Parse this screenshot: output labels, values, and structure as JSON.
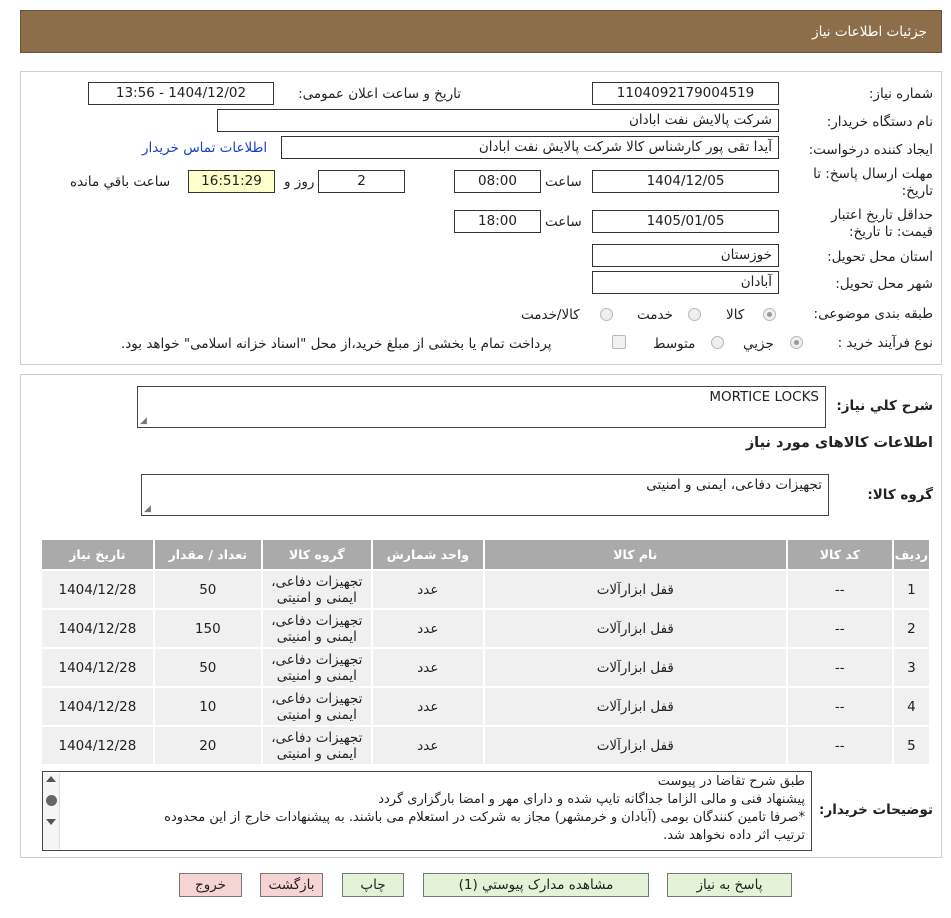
{
  "header": {
    "title": "جزئیات اطلاعات نیاز"
  },
  "form": {
    "need_number_label": "شماره نیاز:",
    "need_number": "1104092179004519",
    "announce_label": "تاریخ و ساعت اعلان عمومی:",
    "announce_value": "1404/12/02 - 13:56",
    "buyer_org_label": "نام دستگاه خریدار:",
    "buyer_org": "شرکت پالایش نفت ابادان",
    "creator_label": "ایجاد کننده درخواست:",
    "creator": "آیدا تقی پور کارشناس کالا شرکت پالایش نفت ابادان",
    "contact_link": "اطلاعات تماس خریدار",
    "reply_deadline_label_1": "مهلت ارسال پاسخ: تا",
    "reply_deadline_label_2": "تاریخ:",
    "reply_date": "1404/12/05",
    "time_label": "ساعت",
    "reply_time": "08:00",
    "days": "2",
    "days_label": "روز و",
    "remaining_time": "16:51:29",
    "remaining_label": "ساعت باقي مانده",
    "price_validity_label_1": "حداقل تاریخ اعتبار",
    "price_validity_label_2": "قیمت: تا تاریخ:",
    "validity_date": "1405/01/05",
    "validity_time": "18:00",
    "province_label": "استان محل تحویل:",
    "province": "خوزستان",
    "city_label": "شهر محل تحویل:",
    "city": "آبادان",
    "category_label": "طبقه بندی موضوعی:",
    "category_options": [
      "کالا",
      "خدمت",
      "کالا/خدمت"
    ],
    "process_label": "نوع فرآیند خرید :",
    "process_options": [
      "جزیي",
      "متوسط"
    ],
    "payment_note": "پرداخت تمام یا بخشی از مبلغ خرید،از محل \"اسناد خزانه اسلامی\" خواهد بود."
  },
  "details": {
    "summary_label": "شرح کلي نیاز:",
    "summary": "MORTICE LOCKS",
    "items_title": "اطلاعات کالاهای مورد نیاز",
    "group_label": "گروه کالا:",
    "group_value": "تجهیزات دفاعی، ایمنی و امنیتی"
  },
  "table": {
    "headers": [
      "ردیف",
      "کد کالا",
      "نام کالا",
      "واحد شمارش",
      "گروه کالا",
      "تعداد / مقدار",
      "تاریخ نیاز"
    ],
    "rows": [
      [
        "1",
        "--",
        "قفل ابزارآلات",
        "عدد",
        "تجهیزات دفاعی، ایمنی و امنیتی",
        "50",
        "1404/12/28"
      ],
      [
        "2",
        "--",
        "قفل ابزارآلات",
        "عدد",
        "تجهیزات دفاعی، ایمنی و امنیتی",
        "150",
        "1404/12/28"
      ],
      [
        "3",
        "--",
        "قفل ابزارآلات",
        "عدد",
        "تجهیزات دفاعی، ایمنی و امنیتی",
        "50",
        "1404/12/28"
      ],
      [
        "4",
        "--",
        "قفل ابزارآلات",
        "عدد",
        "تجهیزات دفاعی، ایمنی و امنیتی",
        "10",
        "1404/12/28"
      ],
      [
        "5",
        "--",
        "قفل ابزارآلات",
        "عدد",
        "تجهیزات دفاعی، ایمنی و امنیتی",
        "20",
        "1404/12/28"
      ]
    ]
  },
  "buyer_notes": {
    "label": "توضیحات خریدار:",
    "lines": [
      "طبق شرح تقاضا در پیوست",
      "پیشنهاد فنی و مالی الزاما جداگانه تایپ شده و دارای مهر و امضا بارگزاری گردد",
      "*صرفا تامین کنندگان بومی (آبادان و خرمشهر) مجاز به شرکت در استعلام می باشند. به پیشنهادات خارج از این محدوده",
      "ترتیب اثر داده نخواهد شد."
    ]
  },
  "buttons": {
    "reply": "پاسخ به نیاز",
    "attachments": "مشاهده مدارک پیوستي (1)",
    "print": "چاپ",
    "back": "بازگشت",
    "exit": "خروج"
  },
  "colors": {
    "header_bg": "#8c6e4a",
    "button_bg": "#e4f3d8",
    "button_red_bg": "#f7d4d4",
    "table_header_bg": "#aaaaaa"
  }
}
